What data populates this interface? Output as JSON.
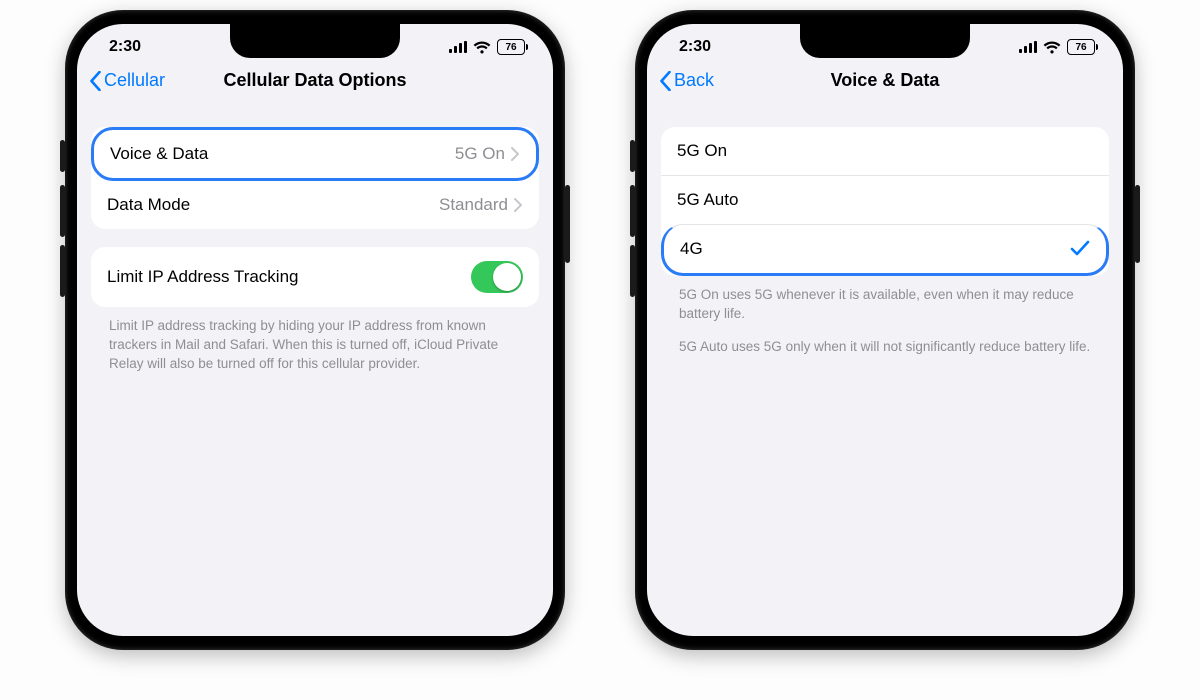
{
  "status": {
    "time": "2:30",
    "battery": "76"
  },
  "phone1": {
    "back_label": "Cellular",
    "title": "Cellular Data Options",
    "group1": [
      {
        "label": "Voice & Data",
        "value": "5G On",
        "highlighted": true
      },
      {
        "label": "Data Mode",
        "value": "Standard",
        "highlighted": false
      }
    ],
    "group2": {
      "label": "Limit IP Address Tracking",
      "toggle_on": true
    },
    "footer": "Limit IP address tracking by hiding your IP address from known trackers in Mail and Safari. When this is turned off, iCloud Private Relay will also be turned off for this cellular provider."
  },
  "phone2": {
    "back_label": "Back",
    "title": "Voice & Data",
    "options": [
      {
        "label": "5G On",
        "selected": false,
        "highlighted": false
      },
      {
        "label": "5G Auto",
        "selected": false,
        "highlighted": false
      },
      {
        "label": "4G",
        "selected": true,
        "highlighted": true
      }
    ],
    "footer1": "5G On uses 5G whenever it is available, even when it may reduce battery life.",
    "footer2": "5G Auto uses 5G only when it will not significantly reduce battery life."
  }
}
